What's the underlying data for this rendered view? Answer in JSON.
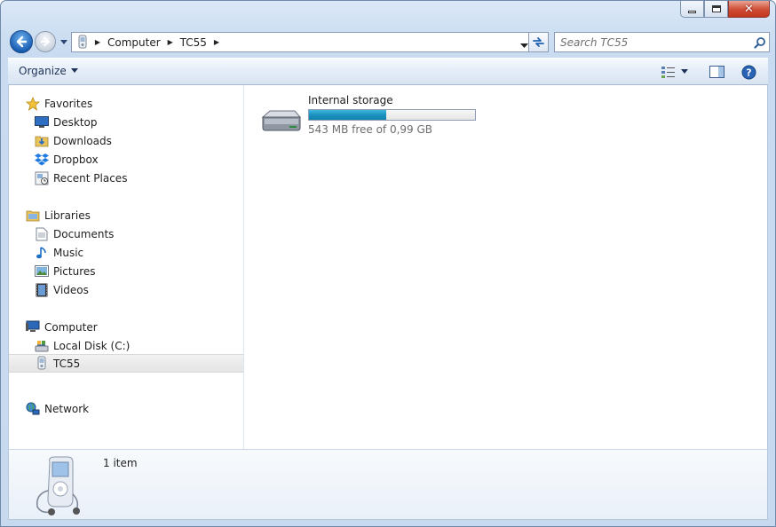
{
  "window": {
    "controls": {
      "minimize_icon": "minimize-icon",
      "maximize_icon": "maximize-icon",
      "close_icon": "close-icon",
      "close_glyph": "✕"
    }
  },
  "address_bar": {
    "breadcrumbs": [
      "Computer",
      "TC55"
    ],
    "search_placeholder": "Search TC55"
  },
  "toolbar": {
    "organize_label": "Organize"
  },
  "nav_pane": {
    "favorites": {
      "label": "Favorites",
      "items": [
        {
          "label": "Desktop",
          "icon": "desktop-icon"
        },
        {
          "label": "Downloads",
          "icon": "downloads-icon"
        },
        {
          "label": "Dropbox",
          "icon": "dropbox-icon"
        },
        {
          "label": "Recent Places",
          "icon": "recent-places-icon"
        }
      ]
    },
    "libraries": {
      "label": "Libraries",
      "items": [
        {
          "label": "Documents",
          "icon": "documents-icon"
        },
        {
          "label": "Music",
          "icon": "music-icon"
        },
        {
          "label": "Pictures",
          "icon": "pictures-icon"
        },
        {
          "label": "Videos",
          "icon": "videos-icon"
        }
      ]
    },
    "computer": {
      "label": "Computer",
      "items": [
        {
          "label": "Local Disk (C:)",
          "icon": "local-disk-icon"
        },
        {
          "label": "TC55",
          "icon": "device-icon",
          "selected": true
        }
      ]
    },
    "network": {
      "label": "Network"
    }
  },
  "main": {
    "drive": {
      "name": "Internal storage",
      "free_text": "543 MB free of 0,99 GB",
      "used_fraction": 0.465
    }
  },
  "details": {
    "item_count": "1 item"
  },
  "colors": {
    "accent": "#1a8fbd",
    "selection": "#e4e4e4",
    "close_red": "#cf4c35"
  }
}
